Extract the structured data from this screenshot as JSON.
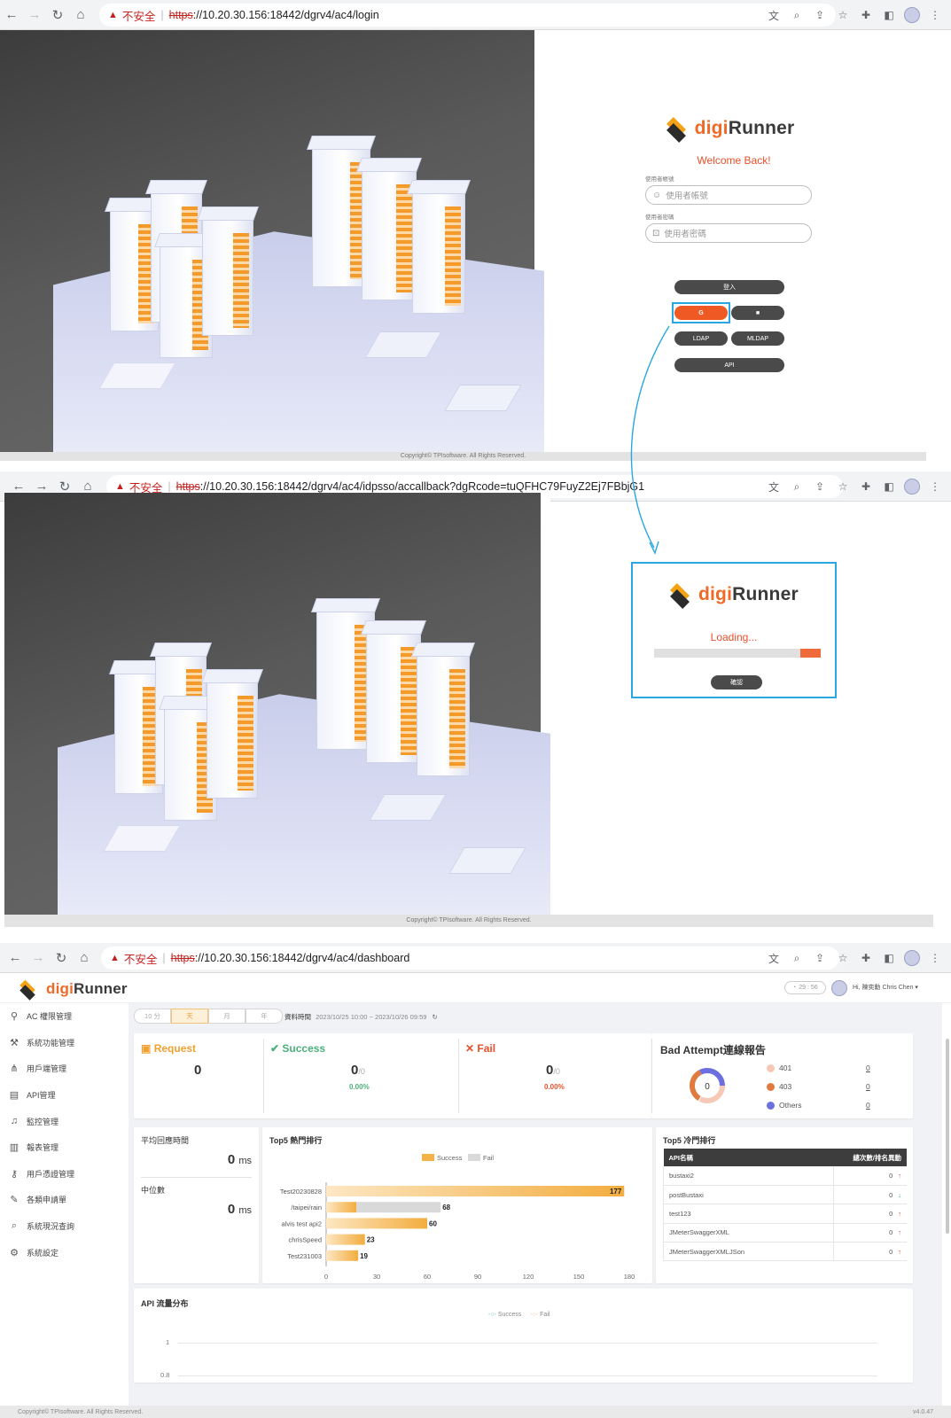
{
  "browser1": {
    "url_rest": "://10.20.30.156:18442/dgrv4/ac4/login",
    "url_scheme": "https",
    "insecure_label": "不安全"
  },
  "browser2": {
    "url_rest": "://10.20.30.156:18442/dgrv4/ac4/idpsso/accallback?dgRcode=tuQFHC79FuyZ2Ej7FBbjG1",
    "url_scheme": "https",
    "insecure_label": "不安全"
  },
  "browser3": {
    "url_rest": "://10.20.30.156:18442/dgrv4/ac4/dashboard",
    "url_scheme": "https",
    "insecure_label": "不安全"
  },
  "brand": {
    "digi": "digi",
    "runner": "Runner"
  },
  "login": {
    "welcome": "Welcome Back!",
    "username_label": "使用者帳號",
    "username_placeholder": "使用者帳號",
    "password_label": "使用者密碼",
    "password_placeholder": "使用者密碼",
    "login_button": "登入",
    "google_button": "G",
    "ms_button": "■",
    "ldap_button": "LDAP",
    "mldap_button": "MLDAP",
    "api_button": "API",
    "copyright": "Copyright© TPIsoftware. All Rights Reserved."
  },
  "loading": {
    "text": "Loading...",
    "progress": 0.12,
    "confirm_button": "確認",
    "copyright": "Copyright© TPIsoftware. All Rights Reserved."
  },
  "dashboard": {
    "timer": "29 : 56",
    "user_greeting": "Hi, 陳奕勳 Chris Chen",
    "sidebar": [
      {
        "icon": "user-shield-icon",
        "glyph": "⚲",
        "label": "AC 權限管理"
      },
      {
        "icon": "tools-icon",
        "glyph": "⚒",
        "label": "系統功能管理"
      },
      {
        "icon": "share-nodes-icon",
        "glyph": "⋔",
        "label": "用戶端管理"
      },
      {
        "icon": "api-server-icon",
        "glyph": "▤",
        "label": "API管理"
      },
      {
        "icon": "bell-icon",
        "glyph": "♫",
        "label": "監控管理"
      },
      {
        "icon": "bar-chart-icon",
        "glyph": "▥",
        "label": "報表管理"
      },
      {
        "icon": "key-icon",
        "glyph": "⚷",
        "label": "用戶憑證管理"
      },
      {
        "icon": "edit-icon",
        "glyph": "✎",
        "label": "各類申請單"
      },
      {
        "icon": "search-icon",
        "glyph": "⌕",
        "label": "系統現況查詢"
      },
      {
        "icon": "gear-icon",
        "glyph": "⚙",
        "label": "系統設定"
      }
    ],
    "time_tabs": [
      "10 分",
      "天",
      "月",
      "年"
    ],
    "active_tab": 1,
    "data_time_label": "資料時間",
    "data_time_value": "2023/10/25 10:00 ~ 2023/10/26 09:59",
    "request": {
      "label": "Request",
      "value": "0"
    },
    "success": {
      "label": "Success",
      "value": "0",
      "sub": "/0",
      "pct": "0.00%"
    },
    "fail": {
      "label": "Fail",
      "value": "0",
      "sub": "/0",
      "pct": "0.00%"
    },
    "bad_attempt": {
      "title": "Bad Attempt連線報告",
      "center": "0",
      "items": [
        {
          "label": "401",
          "value": "0",
          "color": "#f5c9b5"
        },
        {
          "label": "403",
          "value": "0",
          "color": "#e07a3f"
        },
        {
          "label": "Others",
          "value": "0",
          "color": "#6b6fe0"
        }
      ]
    },
    "avg_response": {
      "label": "平均回應時間",
      "value": "0",
      "unit": "ms"
    },
    "median": {
      "label": "中位數",
      "value": "0",
      "unit": "ms"
    },
    "top5_hot_title": "Top5 熱門排行",
    "top5_cold": {
      "title": "Top5 冷門排行",
      "col_name": "API名稱",
      "col_count": "總次數/排名異動",
      "rows": [
        {
          "name": "bustaxi2",
          "count": "0",
          "trend": "up"
        },
        {
          "name": "postBustaxi",
          "count": "0",
          "trend": "down"
        },
        {
          "name": "test123",
          "count": "0",
          "trend": "up"
        },
        {
          "name": "JMeterSwaggerXML",
          "count": "0",
          "trend": "up"
        },
        {
          "name": "JMeterSwaggerXMLJSon",
          "count": "0",
          "trend": "up"
        }
      ]
    },
    "traffic_title": "API 流量分布",
    "traffic_legend": [
      "Success",
      "Fail"
    ],
    "traffic_yticks": [
      "1",
      "0.8"
    ],
    "footer_left": "Copyright© TPIsoftware. All Rights Reserved.",
    "footer_right": "v4.0.47"
  },
  "chart_data": {
    "type": "bar",
    "orientation": "horizontal",
    "stacked": true,
    "categories": [
      "Test20230828",
      "/taipei/rain",
      "alvis test api2",
      "chrisSpeed",
      "Test231003"
    ],
    "series": [
      {
        "name": "Success",
        "values": [
          177,
          18,
          60,
          23,
          19
        ],
        "color": "#f3b24a"
      },
      {
        "name": "Fail",
        "values": [
          0,
          50,
          0,
          0,
          0
        ],
        "color": "#d9d9d9"
      }
    ],
    "totals": [
      177,
      68,
      60,
      23,
      19
    ],
    "xlim": [
      0,
      180
    ],
    "xticks": [
      0,
      30,
      60,
      90,
      120,
      150,
      180
    ],
    "legend": "top"
  }
}
